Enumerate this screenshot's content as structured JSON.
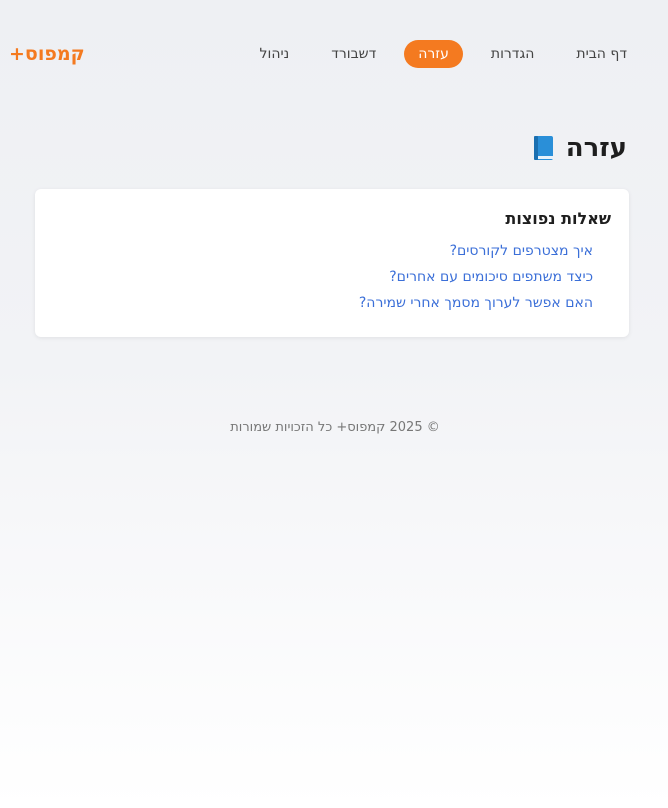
{
  "brand": {
    "logo_text": "קמפוס+"
  },
  "nav": {
    "items": [
      {
        "label": "דף הבית"
      },
      {
        "label": "הגדרות"
      },
      {
        "label": "עזרה"
      },
      {
        "label": "דשבורד"
      },
      {
        "label": "ניהול"
      }
    ],
    "active_index": 2
  },
  "page": {
    "title": "עזרה",
    "title_icon": "book-icon"
  },
  "faq": {
    "heading": "שאלות נפוצות",
    "questions": [
      "איך מצטרפים לקורסים?",
      "כיצד משתפים סיכומים עם אחרים?",
      "האם אפשר לערוך מסמך אחרי שמירה?"
    ]
  },
  "footer": {
    "text": "© 2025 קמפוס+ כל הזכויות שמורות"
  },
  "colors": {
    "accent": "#f47a20",
    "link": "#3b6fd8"
  }
}
